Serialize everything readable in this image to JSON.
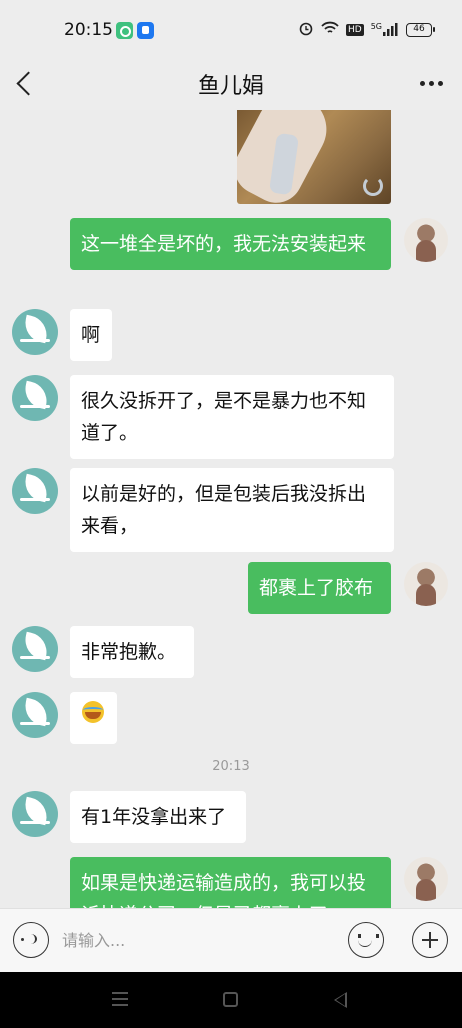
{
  "status_bar": {
    "time": "20:15",
    "network_label": "HD",
    "signal_label": "5G",
    "battery_level": "46",
    "icons": [
      "green-app-icon",
      "blue-app-icon",
      "alarm-icon",
      "wifi-icon",
      "hd-icon",
      "signal-icon",
      "battery-icon"
    ]
  },
  "header": {
    "title": "鱼儿娟",
    "back_icon": "chevron-left-icon",
    "more_icon": "more-dots-icon"
  },
  "messages": [
    {
      "from": "me",
      "type": "image"
    },
    {
      "from": "me",
      "type": "text",
      "text": "这一堆全是坏的，我无法安装起来"
    },
    {
      "from": "them",
      "type": "text",
      "text": "啊"
    },
    {
      "from": "them",
      "type": "text",
      "text": "很久没拆开了，是不是暴力也不知道了。"
    },
    {
      "from": "them",
      "type": "text",
      "text": "以前是好的，但是包装后我没拆出来看，"
    },
    {
      "from": "me",
      "type": "text",
      "text": "都裹上了胶布"
    },
    {
      "from": "them",
      "type": "text",
      "text": "非常抱歉。"
    },
    {
      "from": "them",
      "type": "emoji",
      "emoji": "cry-laugh-emoji"
    },
    {
      "from": "system",
      "type": "timestamp",
      "text": "20:13"
    },
    {
      "from": "them",
      "type": "text",
      "text": "有1年没拿出来了"
    },
    {
      "from": "me",
      "type": "text",
      "text": "如果是快递运输造成的，我可以投诉快递公司，但是已都裹上了"
    }
  ],
  "input_bar": {
    "placeholder": "请输入...",
    "voice_icon": "voice-icon",
    "emoji_icon": "smiley-icon",
    "plus_icon": "plus-icon"
  },
  "colors": {
    "my_bubble": "#49bd5f",
    "their_bubble": "#ffffff",
    "chat_background": "#ececec",
    "shop_avatar": "#6fb7b2"
  }
}
